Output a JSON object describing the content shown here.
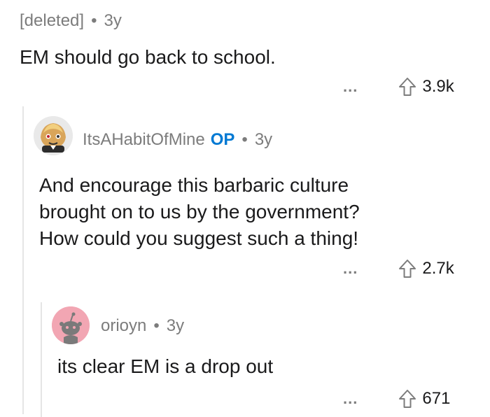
{
  "comments": [
    {
      "author": "[deleted]",
      "age": "3y",
      "body": [
        "EM should go back to school."
      ],
      "votes": "3.9k",
      "more": "..."
    },
    {
      "author": "ItsAHabitOfMine",
      "op_badge": "OP",
      "age": "3y",
      "body": [
        "And encourage this barbaric culture",
        "brought on to us by the government?",
        "How could you suggest such a thing!"
      ],
      "votes": "2.7k",
      "more": "...",
      "avatar_icon": "cartoon-avatar-icon"
    },
    {
      "author": "orioyn",
      "age": "3y",
      "body": [
        "its clear EM is a drop out"
      ],
      "votes": "671",
      "more": "...",
      "avatar_icon": "snoo-avatar-icon",
      "avatar_color": "#f2a6b3"
    }
  ],
  "separator": "•",
  "icons": {
    "upvote": "upvote-arrow-icon"
  }
}
